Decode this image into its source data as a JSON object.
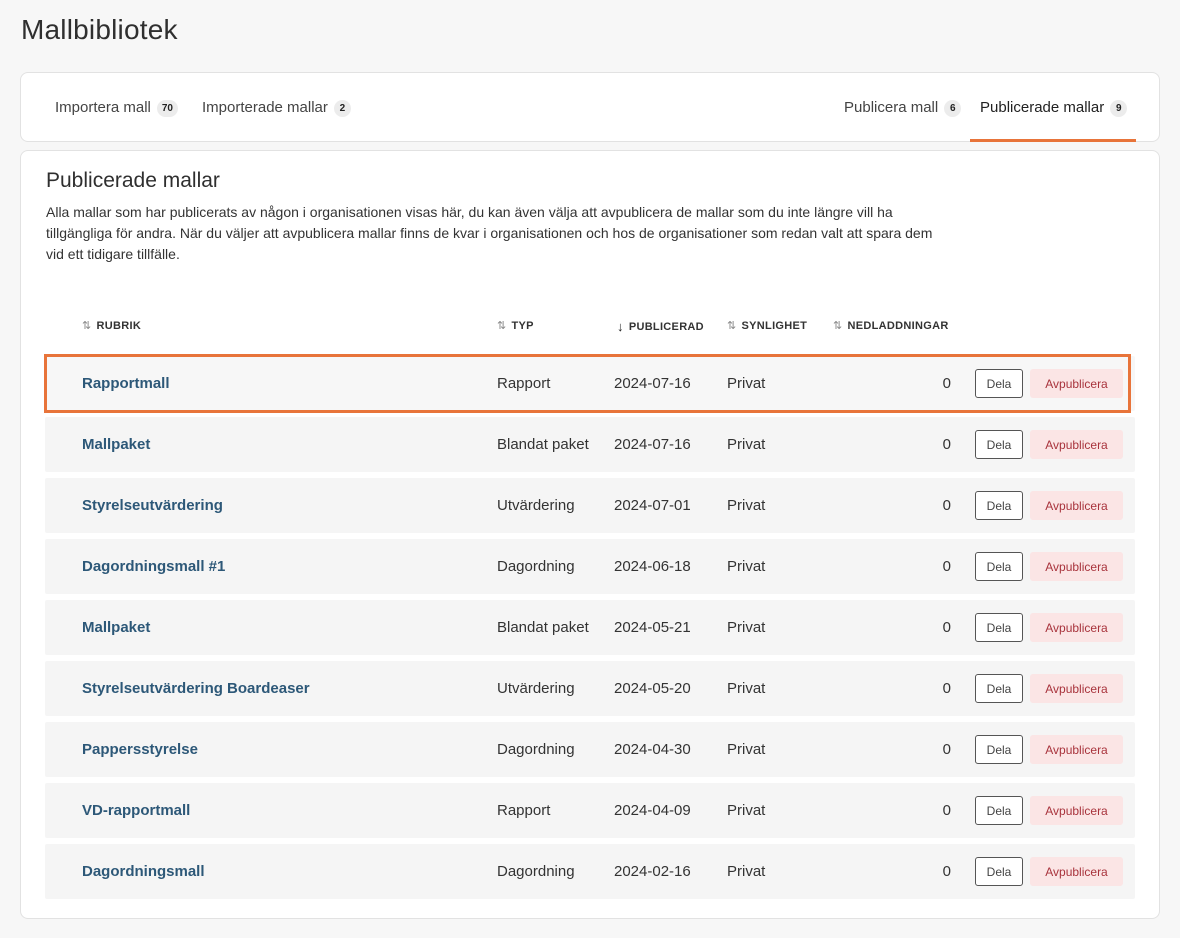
{
  "page_title": "Mallbibliotek",
  "tabs": [
    {
      "label": "Importera mall",
      "count": "70"
    },
    {
      "label": "Importerade mallar",
      "count": "2"
    },
    {
      "label": "Publicera mall",
      "count": "6"
    },
    {
      "label": "Publicerade mallar",
      "count": "9"
    }
  ],
  "section": {
    "title": "Publicerade mallar",
    "description": "Alla mallar som har publicerats av någon i organisationen visas här, du kan även välja att avpublicera de mallar som du inte längre vill ha tillgängliga för andra. När du väljer att avpublicera mallar finns de kvar i organisationen och hos de organisationer som redan valt att spara dem vid ett tidigare tillfälle."
  },
  "columns": {
    "title": "RUBRIK",
    "type": "TYP",
    "published": "PUBLICERAD",
    "visibility": "SYNLIGHET",
    "downloads": "NEDLADDNINGAR"
  },
  "icons": {
    "sort_neutral": "⇅",
    "sort_desc": "↓"
  },
  "actions": {
    "share": "Dela",
    "unpublish": "Avpublicera"
  },
  "colors": {
    "accent": "#e8743a",
    "link": "#2d5878",
    "danger_text": "#a8333c",
    "danger_bg": "#fbe5e5"
  },
  "rows": [
    {
      "title": "Rapportmall",
      "type": "Rapport",
      "published": "2024-07-16",
      "visibility": "Privat",
      "downloads": "0"
    },
    {
      "title": "Mallpaket",
      "type": "Blandat paket",
      "published": "2024-07-16",
      "visibility": "Privat",
      "downloads": "0"
    },
    {
      "title": "Styrelseutvärdering",
      "type": "Utvärdering",
      "published": "2024-07-01",
      "visibility": "Privat",
      "downloads": "0"
    },
    {
      "title": "Dagordningsmall #1",
      "type": "Dagordning",
      "published": "2024-06-18",
      "visibility": "Privat",
      "downloads": "0"
    },
    {
      "title": "Mallpaket",
      "type": "Blandat paket",
      "published": "2024-05-21",
      "visibility": "Privat",
      "downloads": "0"
    },
    {
      "title": "Styrelseutvärdering Boardeaser",
      "type": "Utvärdering",
      "published": "2024-05-20",
      "visibility": "Privat",
      "downloads": "0"
    },
    {
      "title": "Pappersstyrelse",
      "type": "Dagordning",
      "published": "2024-04-30",
      "visibility": "Privat",
      "downloads": "0"
    },
    {
      "title": "VD-rapportmall",
      "type": "Rapport",
      "published": "2024-04-09",
      "visibility": "Privat",
      "downloads": "0"
    },
    {
      "title": "Dagordningsmall",
      "type": "Dagordning",
      "published": "2024-02-16",
      "visibility": "Privat",
      "downloads": "0"
    }
  ]
}
